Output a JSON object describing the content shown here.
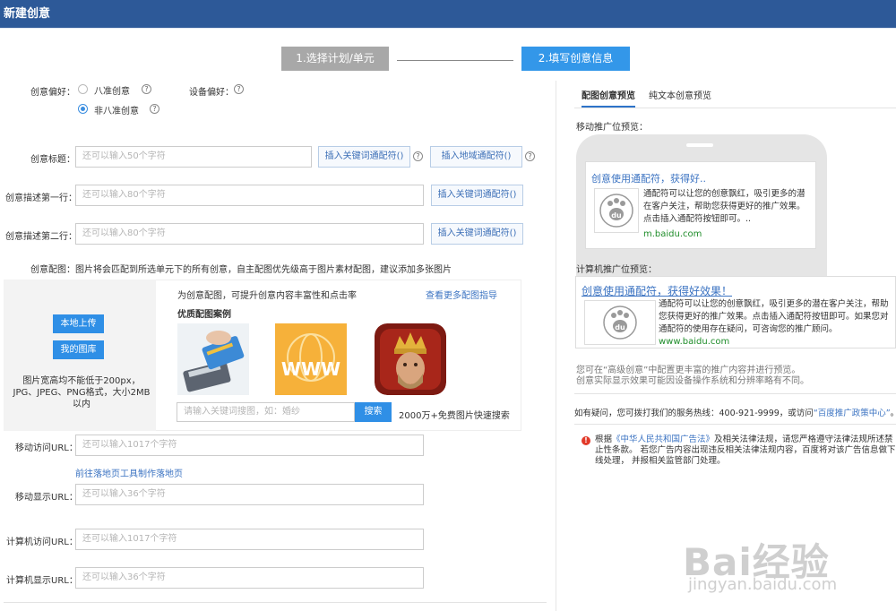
{
  "window": {
    "title": "新建创意"
  },
  "steps": [
    {
      "label": "1.选择计划/单元"
    },
    {
      "label": "2.填写创意信息"
    }
  ],
  "preference": {
    "creative_label": "创意偏好：",
    "opt1": "八准创意",
    "opt2": "非八准创意",
    "device_label": "设备偏好："
  },
  "title_field": {
    "label": "创意标题：",
    "placeholder": "还可以输入50个字符",
    "btn_keyword": "插入关键词通配符()",
    "btn_region": "插入地域通配符()"
  },
  "desc1": {
    "label": "创意描述第一行：",
    "placeholder": "还可以输入80个字符",
    "btn": "插入关键词通配符()"
  },
  "desc2": {
    "label": "创意描述第二行：",
    "placeholder": "还可以输入80个字符",
    "btn": "插入关键词通配符()"
  },
  "image_config": {
    "label": "创意配图：",
    "note": "图片将会匹配到所选单元下的所有创意，自主配图优先级高于图片素材配图，建议添加多张图片",
    "btn_upload": "本地上传",
    "btn_library": "我的图库",
    "spec": "图片宽高均不能低于200px，JPG、JPEG、PNG格式，大小2MB以内",
    "promo": "为创意配图，可提升创意内容丰富性和点击率",
    "more_link": "查看更多配图指导",
    "cases_title": "优质配图案例",
    "search_placeholder": "请输入关键词搜图，如：婚纱",
    "search_btn": "搜索",
    "search_note": "2000万+免费图片快速搜索"
  },
  "mobile_url": {
    "label": "移动访问URL：",
    "placeholder": "还可以输入1017个字符",
    "landing_link": "前往落地页工具制作落地页"
  },
  "mobile_display": {
    "label": "移动显示URL：",
    "placeholder": "还可以输入36个字符"
  },
  "pc_url": {
    "label": "计算机访问URL：",
    "placeholder": "还可以输入1017个字符"
  },
  "pc_display": {
    "label": "计算机显示URL：",
    "placeholder": "还可以输入36个字符"
  },
  "preview": {
    "tab_image": "配图创意预览",
    "tab_text": "纯文本创意预览",
    "mobile_label": "移动推广位预览：",
    "mobile_title": "创意使用通配符，获得好..",
    "mobile_desc": "通配符可以让您的创意飘红，吸引更多的潜在客户关注，帮助您获得更好的推广效果。点击插入通配符按钮即可。..",
    "mobile_url": "m.baidu.com",
    "pc_label": "计算机推广位预览：",
    "pc_title": "创意使用通配符，获得好效果！",
    "pc_desc": "通配符可以让您的创意飘红，吸引更多的潜在客户关注，帮助您获得更好的推广效果。点击插入通配符按钮即可。如果您对通配符的使用存在疑问，可咨询您的推广顾问。",
    "pc_url": "www.baidu.com",
    "note1": "您可在“高级创意”中配置更丰富的推广内容并进行预览。",
    "note2": "创意实际显示效果可能因设备操作系统和分辨率略有不同。",
    "help_prefix": "如有疑问，您可拨打我们的服务热线：400-921-9999，或访问",
    "help_link": "“百度推广政策中心”",
    "help_suffix": "。",
    "legal_1": "根据",
    "legal_link": "《中华人民共和国广告法》",
    "legal_2": "及相关法律法规，请您严格遵守法律法规所述禁止性条款。 若您广告内容出现违反相关法律法规内容，百度将对该广告信息做下线处理， 并报相关监管部门处理。"
  },
  "watermark": {
    "brand": "Bai经验",
    "url": "jingyan.baidu.com"
  },
  "colors": {
    "header": "#2d5998",
    "primary": "#2f8fe6",
    "step_inactive": "#a8a8a8"
  }
}
